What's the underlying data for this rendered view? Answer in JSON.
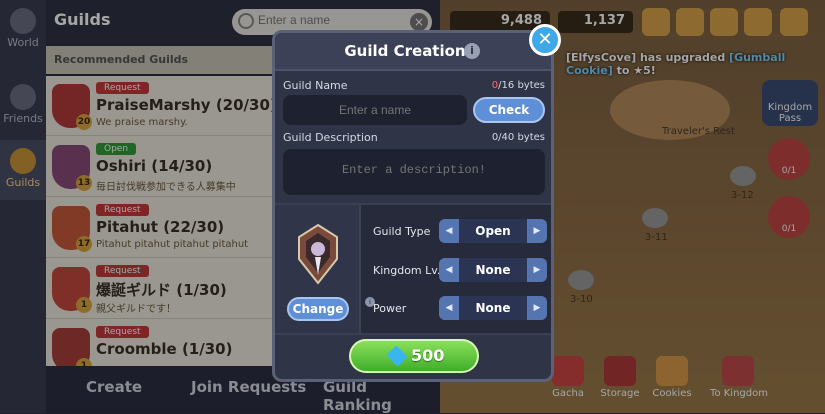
{
  "background": {
    "nav": {
      "world": "World",
      "friends": "Friends",
      "guilds": "Guilds"
    },
    "header": {
      "title": "Guilds",
      "search_placeholder": "Enter a name"
    },
    "recommended_label": "Recommended Guilds",
    "guilds": [
      {
        "badge": "Request",
        "name": "PraiseMarshy",
        "count": "(20/30)",
        "desc": "We praise marshy.",
        "level": "20"
      },
      {
        "badge": "Open",
        "name": "Oshiri",
        "count": "(14/30)",
        "desc": "毎日討伐戦参加できる人募集中",
        "level": "13"
      },
      {
        "badge": "Request",
        "name": "Pitahut",
        "count": "(22/30)",
        "desc": "Pitahut pitahut pitahut pitahut",
        "level": "17"
      },
      {
        "badge": "Request",
        "name": "爆誕ギルド",
        "count": "(1/30)",
        "desc": "親父ギルドです！",
        "level": "1"
      },
      {
        "badge": "Request",
        "name": "Croomble",
        "count": "(1/30)",
        "desc": "",
        "level": "1"
      }
    ],
    "bottom_tabs": {
      "create": "Create",
      "join_requests": "Join Requests",
      "guild_ranking": "Guild Ranking"
    },
    "resources": {
      "coins": "9,488",
      "gems": "1,137"
    },
    "notice": {
      "user": "[ElfysCove]",
      "mid": " has upgraded ",
      "item": "[Gumball Cookie]",
      "end": " to ★5!"
    },
    "map_labels": {
      "area1": "Traveler's Rest",
      "area2": "3-12",
      "area3": "3-11",
      "area4": "3-10"
    },
    "kingdom_pass": "Kingdom Pass",
    "side_counts": [
      "0/1",
      "0/1"
    ],
    "dock": [
      "Gacha",
      "Storage",
      "Cookies",
      "To Kingdom"
    ]
  },
  "modal": {
    "title": "Guild Creation",
    "name_label": "Guild Name",
    "name_used": "0",
    "name_limit": "/16 bytes",
    "name_placeholder": "Enter a name",
    "check_label": "Check",
    "desc_label": "Guild Description",
    "desc_counter": "0/40 bytes",
    "desc_placeholder": "Enter a description!",
    "change_label": "Change",
    "settings": {
      "type_label": "Guild Type",
      "type_value": "Open",
      "level_label": "Kingdom Lv.",
      "level_value": "None",
      "power_label": "Power",
      "power_value": "None"
    },
    "create_cost": "500"
  }
}
